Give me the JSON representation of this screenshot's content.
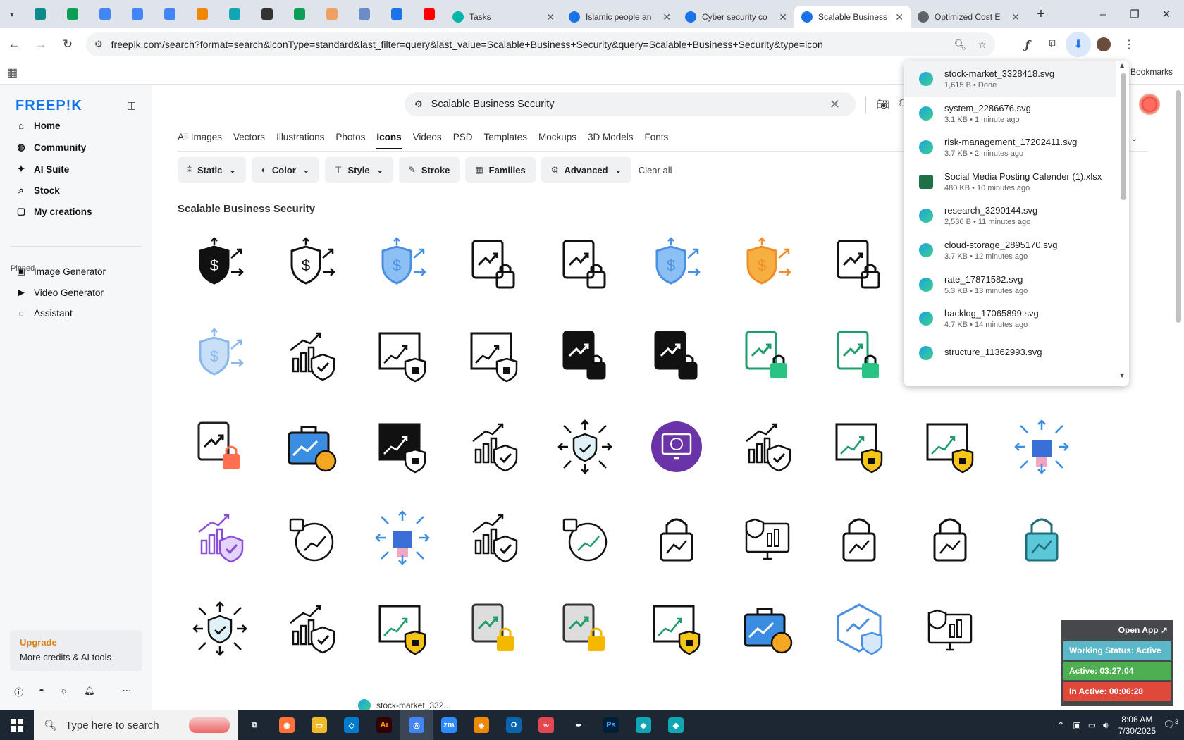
{
  "browser": {
    "tabs": [
      {
        "title": "Tasks",
        "icon_color": "#00b8a9"
      },
      {
        "title": "Islamic people an",
        "icon_color": "#1a73e8"
      },
      {
        "title": "Cyber security co",
        "icon_color": "#1a73e8"
      },
      {
        "title": "Scalable Business",
        "icon_color": "#1a73e8",
        "active": true
      },
      {
        "title": "Optimized Cost E",
        "icon_color": "#5f6368"
      }
    ],
    "pinned_icons": [
      "vpn-icon",
      "sheets-icon",
      "docs-icon",
      "docs-icon",
      "docs-icon",
      "drawio-icon",
      "app-icon",
      "chatgpt-icon",
      "sheets-icon",
      "hand-icon",
      "calculator-icon",
      "forms-icon",
      "youtube-icon"
    ],
    "new_tab": "+",
    "url": "freepik.com/search?format=search&iconType=standard&last_filter=query&last_value=Scalable+Business+Security&query=Scalable+Business+Security&type=icon",
    "all_bookmarks": "All Bookmarks",
    "window_controls": {
      "minimize": "–",
      "restore": "❐",
      "close": "✕"
    }
  },
  "sidebar": {
    "logo": "FREEP!K",
    "nav": [
      {
        "label": "Home",
        "icon": "home-icon"
      },
      {
        "label": "Community",
        "icon": "globe-icon"
      },
      {
        "label": "AI Suite",
        "icon": "sparkle-icon"
      },
      {
        "label": "Stock",
        "icon": "search-icon"
      },
      {
        "label": "My creations",
        "icon": "folder-icon"
      }
    ],
    "pinned_label": "Pinned",
    "pinned": [
      {
        "label": "Image Generator",
        "icon": "image-icon"
      },
      {
        "label": "Video Generator",
        "icon": "video-icon"
      },
      {
        "label": "Assistant",
        "icon": "chat-icon"
      }
    ],
    "upgrade_title": "Upgrade",
    "upgrade_sub": "More credits & AI tools",
    "footer_icons": [
      "help-icon",
      "discord-icon",
      "theme-icon",
      "bell-icon",
      "more-icon"
    ]
  },
  "search": {
    "value": "Scalable Business Security"
  },
  "categories": [
    {
      "label": "All Images"
    },
    {
      "label": "Vectors"
    },
    {
      "label": "Illustrations"
    },
    {
      "label": "Photos"
    },
    {
      "label": "Icons",
      "active": true
    },
    {
      "label": "Videos"
    },
    {
      "label": "PSD"
    },
    {
      "label": "Templates"
    },
    {
      "label": "Mockups"
    },
    {
      "label": "3D Models"
    },
    {
      "label": "Fonts"
    }
  ],
  "filters": [
    {
      "label": "Static",
      "dropdown": true,
      "icon": "static-icon"
    },
    {
      "label": "Color",
      "dropdown": true,
      "icon": "palette-icon"
    },
    {
      "label": "Style",
      "dropdown": true,
      "icon": "brush-icon"
    },
    {
      "label": "Stroke",
      "dropdown": false,
      "icon": "pen-icon"
    },
    {
      "label": "Families",
      "dropdown": false,
      "icon": "grid-icon"
    },
    {
      "label": "Advanced",
      "dropdown": true,
      "icon": "gear-icon"
    }
  ],
  "clear_all": "Clear all",
  "results_title": "Scalable Business Security",
  "icon_grid": [
    [
      "shield-dollar-icon",
      "shield-dollar-outline-icon",
      "shield-dollar-blue-icon",
      "chart-lock-icon",
      "chart-lock-icon",
      "shield-dollar-blue-icon",
      "shield-dollar-orange-icon",
      "chart-lock-icon",
      "",
      ""
    ],
    [
      "shield-dollar-light-icon",
      "growth-shield-icon",
      "board-shield-icon",
      "board-shield-icon",
      "chart-lock-solid-icon",
      "chart-lock-solid-icon",
      "chart-lock-green-icon",
      "chart-lock-green-icon",
      "",
      ""
    ],
    [
      "chart-lock-orange-icon",
      "briefcase-shield-icon",
      "board-shield-solid-icon",
      "growth-shield-icon",
      "arrows-shield-icon",
      "monitor-lock-purple-icon",
      "growth-shield-icon",
      "board-shield-yellow-icon",
      "board-shield-yellow-icon",
      "arrows-lock-icon"
    ],
    [
      "growth-shield-purple-icon",
      "lock-chart-icon",
      "arrows-lock-icon",
      "growth-shield-icon",
      "lock-chart-green-icon",
      "padlock-chart-icon",
      "monitor-shield-icon",
      "padlock-circuit-icon",
      "padlock-arrows-icon",
      "padlock-chart-cyan-icon"
    ],
    [
      "arrows-shield-icon",
      "growth-shield-icon",
      "board-shield-yellow-icon",
      "chart-lock-yellow-icon",
      "chart-lock-yellow-icon",
      "board-shield-yellow-icon",
      "briefcase-shield-icon",
      "hexagon-shield-icon",
      "monitor-lock-icon",
      ""
    ]
  ],
  "downloads": [
    {
      "name": "stock-market_3328418.svg",
      "meta": "1,615 B • Done",
      "type": "edge"
    },
    {
      "name": "system_2286676.svg",
      "meta": "3.1 KB • 1 minute ago",
      "type": "edge"
    },
    {
      "name": "risk-management_17202411.svg",
      "meta": "3.7 KB • 2 minutes ago",
      "type": "edge"
    },
    {
      "name": "Social Media Posting Calender (1).xlsx",
      "meta": "480 KB • 10 minutes ago",
      "type": "excel"
    },
    {
      "name": "research_3290144.svg",
      "meta": "2,536 B • 11 minutes ago",
      "type": "edge"
    },
    {
      "name": "cloud-storage_2895170.svg",
      "meta": "3.7 KB • 12 minutes ago",
      "type": "edge"
    },
    {
      "name": "rate_17871582.svg",
      "meta": "5.3 KB • 13 minutes ago",
      "type": "edge"
    },
    {
      "name": "backlog_17065899.svg",
      "meta": "4.7 KB • 14 minutes ago",
      "type": "edge"
    },
    {
      "name": "structure_11362993.svg",
      "meta": "",
      "type": "edge"
    }
  ],
  "download_shelf_item": "stock-market_332...",
  "status_widget": {
    "open_app": "Open App ↗",
    "working": "Working Status: Active",
    "active": "Active: 03:27:04",
    "inactive": "In Active: 00:06:28",
    "colors": {
      "working": "#5bb8c9",
      "active": "#4caf50",
      "inactive": "#e0493a"
    }
  },
  "taskbar": {
    "search_placeholder": "Type here to search",
    "apps": [
      "task-view-icon",
      "firefox-icon",
      "file-explorer-icon",
      "vscode-icon",
      "illustrator-icon",
      "chrome-icon",
      "zoom-icon",
      "drawio-icon",
      "outlook-icon",
      "creative-cloud-icon",
      "pen-tool-icon",
      "photoshop-icon",
      "app-icon",
      "app-icon"
    ],
    "time": "8:06 AM",
    "date": "7/30/2025",
    "notification_count": "3"
  }
}
